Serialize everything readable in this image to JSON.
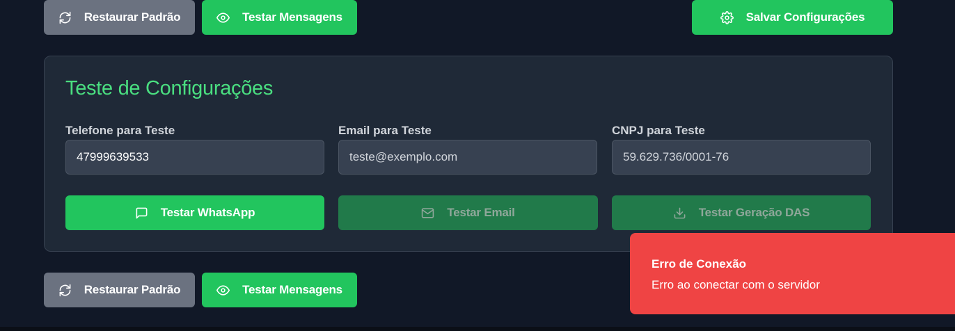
{
  "top_actions": {
    "reset_label": "Restaurar Padrão",
    "test_messages_label": "Testar Mensagens",
    "save_label": "Salvar Configurações"
  },
  "test_card": {
    "title": "Teste de Configurações",
    "fields": [
      {
        "label": "Telefone para Teste",
        "value": "47999639533",
        "placeholder": ""
      },
      {
        "label": "Email para Teste",
        "value": "",
        "placeholder": "teste@exemplo.com"
      },
      {
        "label": "CNPJ para Teste",
        "value": "",
        "placeholder": "59.629.736/0001-76"
      }
    ],
    "buttons": [
      {
        "label": "Testar WhatsApp",
        "icon": "message-square-icon",
        "enabled": true
      },
      {
        "label": "Testar Email",
        "icon": "mail-icon",
        "enabled": false
      },
      {
        "label": "Testar Geração DAS",
        "icon": "download-icon",
        "enabled": false
      }
    ]
  },
  "bottom_actions": {
    "reset_label": "Restaurar Padrão",
    "test_messages_label": "Testar Mensagens"
  },
  "toast": {
    "title": "Erro de Conexão",
    "message": "Erro ao conectar com o servidor"
  },
  "colors": {
    "background": "#111827",
    "card": "#1f2937",
    "accent_green": "#22c55e",
    "title_green": "#4ade80",
    "gray_button": "#6b7280",
    "disabled_green": "#217a4a",
    "toast_red": "#ef4444"
  }
}
